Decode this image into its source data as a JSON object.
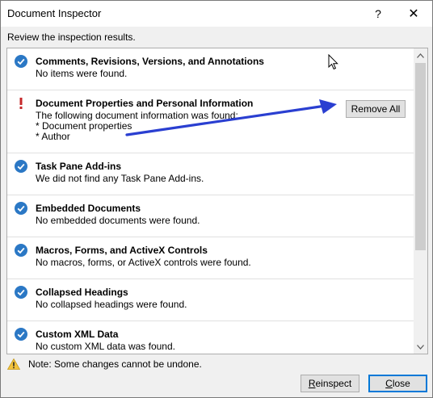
{
  "window": {
    "title": "Document Inspector",
    "help_glyph": "?",
    "close_glyph": "✕"
  },
  "instructions": "Review the inspection results.",
  "items": [
    {
      "status": "ok",
      "name": "Comments, Revisions, Versions, and Annotations",
      "result": "No items were found."
    },
    {
      "status": "found",
      "name": "Document Properties and Personal Information",
      "result": "The following document information was found:\n* Document properties\n* Author",
      "action": "Remove All"
    },
    {
      "status": "ok",
      "name": "Task Pane Add-ins",
      "result": "We did not find any Task Pane Add-ins."
    },
    {
      "status": "ok",
      "name": "Embedded Documents",
      "result": "No embedded documents were found."
    },
    {
      "status": "ok",
      "name": "Macros, Forms, and ActiveX Controls",
      "result": "No macros, forms, or ActiveX controls were found."
    },
    {
      "status": "ok",
      "name": "Collapsed Headings",
      "result": "No collapsed headings were found."
    },
    {
      "status": "ok",
      "name": "Custom XML Data",
      "result": "No custom XML data was found."
    }
  ],
  "note": "Note: Some changes cannot be undone.",
  "buttons": {
    "reinspect": "Reinspect",
    "close": "Close"
  },
  "colors": {
    "check": "#2b78c5",
    "warning": "#c6282a",
    "annotation_arrow": "#2a3fd1",
    "default_button_border": "#0078d7"
  }
}
